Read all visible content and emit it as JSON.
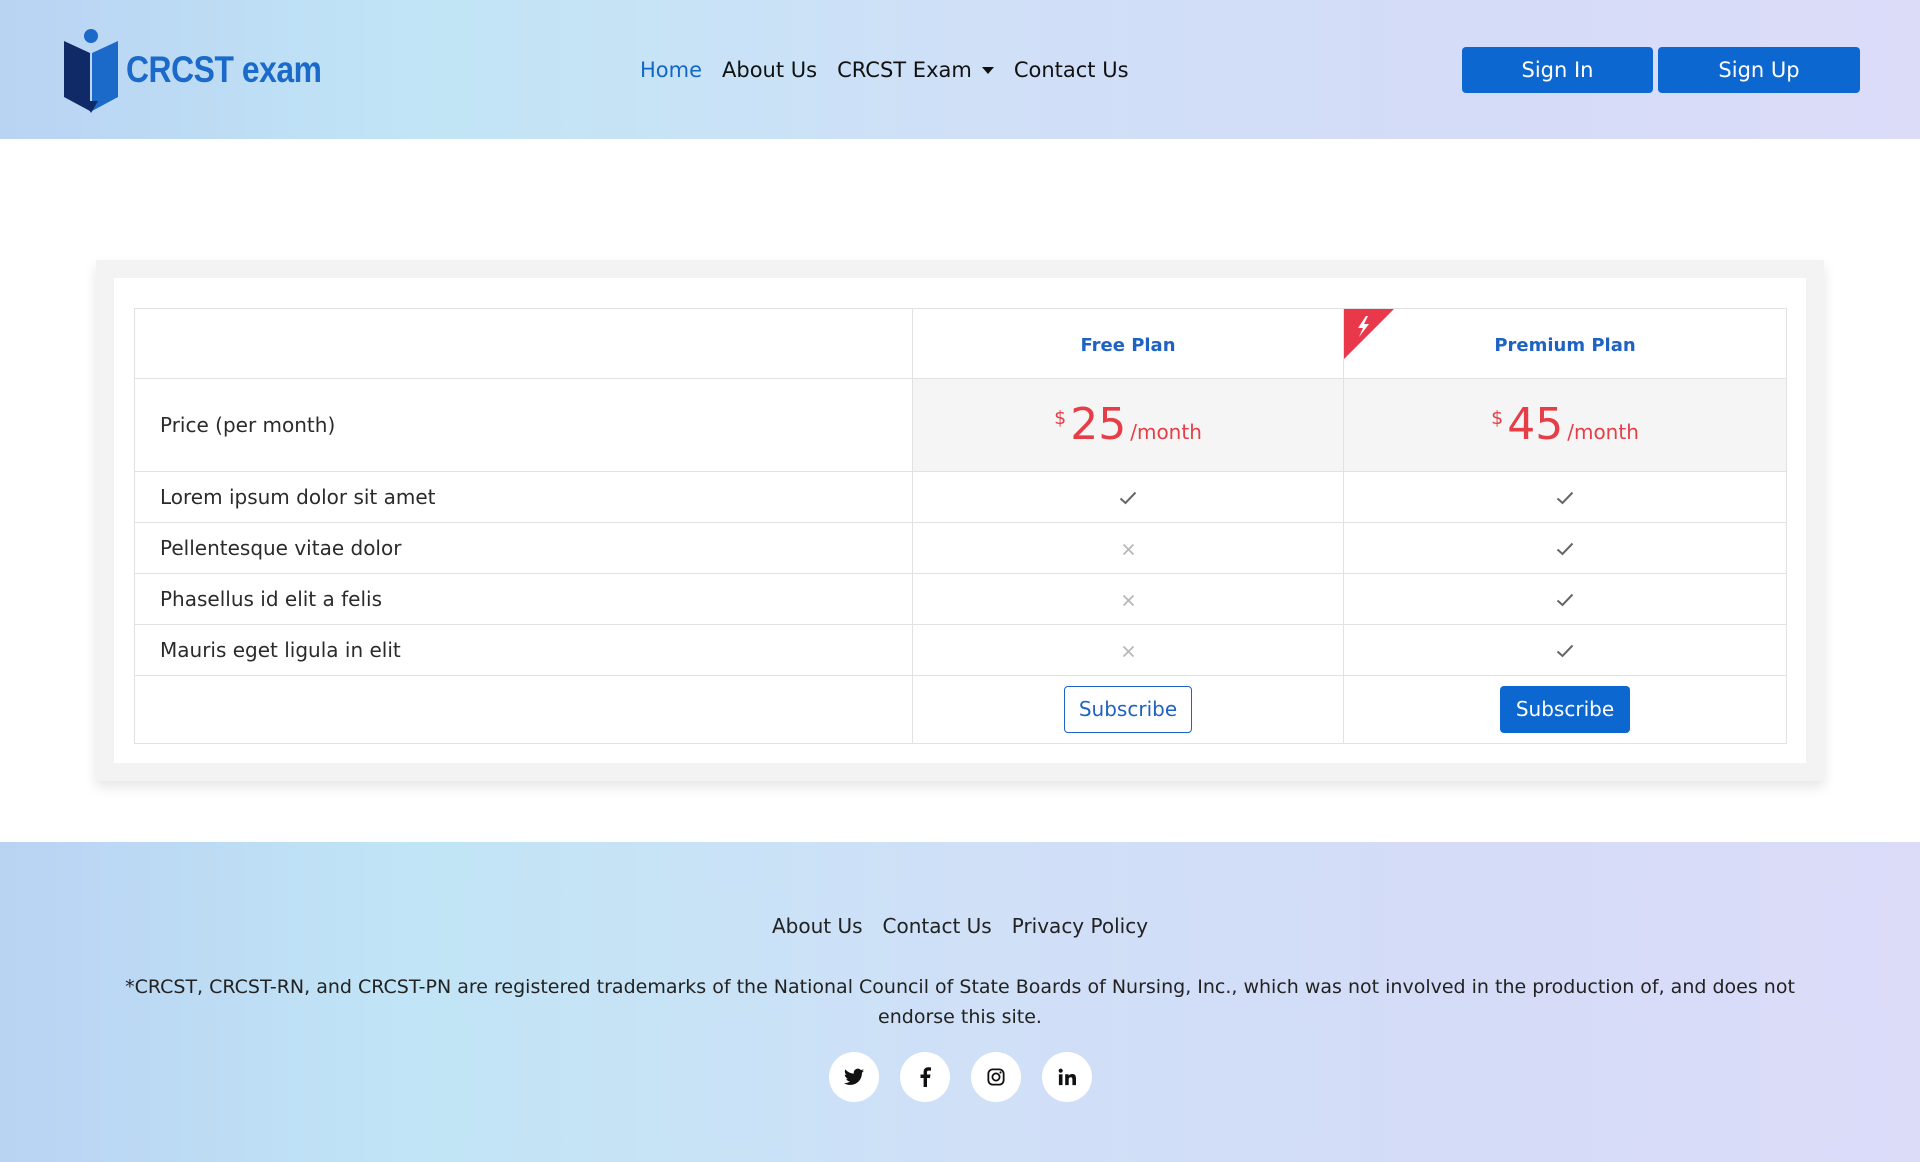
{
  "header": {
    "logo_text": "CRCST exam",
    "nav": [
      {
        "label": "Home",
        "active": true
      },
      {
        "label": "About Us"
      },
      {
        "label": "CRCST Exam",
        "dropdown": true
      },
      {
        "label": "Contact Us"
      }
    ],
    "sign_in": "Sign In",
    "sign_up": "Sign Up"
  },
  "pricing": {
    "plans": [
      {
        "name": "Free Plan",
        "currency": "$",
        "price": "25",
        "period": "/month",
        "button": "Subscribe"
      },
      {
        "name": "Premium Plan",
        "currency": "$",
        "price": "45",
        "period": "/month",
        "button": "Subscribe",
        "ribbon_icon": "lightning-icon"
      }
    ],
    "price_label": "Price (per month)",
    "features": [
      {
        "label": "Lorem ipsum dolor sit amet",
        "free": true,
        "premium": true
      },
      {
        "label": "Pellentesque vitae dolor",
        "free": false,
        "premium": true
      },
      {
        "label": "Phasellus id elit a felis",
        "free": false,
        "premium": true
      },
      {
        "label": "Mauris eget ligula in elit",
        "free": false,
        "premium": true
      }
    ]
  },
  "footer": {
    "links": [
      "About Us",
      "Contact Us",
      "Privacy Policy"
    ],
    "disclaimer": "*CRCST, CRCST-RN, and CRCST-PN are registered trademarks of the National Council of State Boards of Nursing, Inc., which was not involved in the production of, and does not endorse this site.",
    "socials": [
      "twitter-icon",
      "facebook-icon",
      "instagram-icon",
      "linkedin-icon"
    ]
  },
  "colors": {
    "primary": "#0d67d0",
    "price": "#e53e47",
    "ribbon": "#e8384a"
  }
}
